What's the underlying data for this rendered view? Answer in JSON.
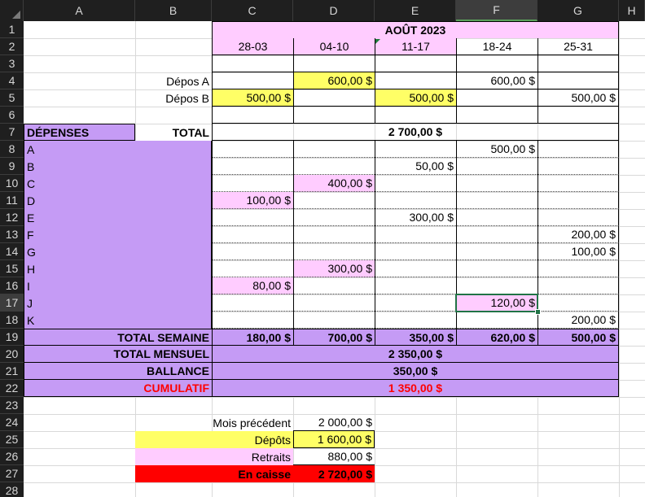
{
  "columns": [
    "A",
    "B",
    "C",
    "D",
    "E",
    "F",
    "G",
    "H"
  ],
  "rows": [
    "1",
    "2",
    "3",
    "4",
    "5",
    "6",
    "7",
    "8",
    "9",
    "10",
    "11",
    "12",
    "13",
    "14",
    "15",
    "16",
    "17",
    "18",
    "19",
    "20",
    "21",
    "22",
    "23",
    "24",
    "25",
    "26",
    "27",
    "28"
  ],
  "selected_column": "F",
  "selected_row": "17",
  "header": {
    "month": "AOÛT 2023",
    "weeks": [
      "28-03",
      "04-10",
      "11-17",
      "18-24",
      "25-31"
    ]
  },
  "deposits": {
    "label_a": "Dépos A",
    "label_b": "Dépos B",
    "a_values": [
      "",
      "600,00 $",
      "",
      "600,00 $",
      ""
    ],
    "b_values": [
      "500,00 $",
      "",
      "500,00 $",
      "",
      "500,00 $"
    ]
  },
  "expenses": {
    "title": "DÉPENSES",
    "total_label": "TOTAL",
    "total_value": "2 700,00 $",
    "items": [
      {
        "name": "A",
        "values": [
          "",
          "",
          "",
          "500,00 $",
          ""
        ]
      },
      {
        "name": "B",
        "values": [
          "",
          "",
          "50,00 $",
          "",
          ""
        ]
      },
      {
        "name": "C",
        "values": [
          "",
          "400,00 $",
          "",
          "",
          ""
        ]
      },
      {
        "name": "D",
        "values": [
          "100,00 $",
          "",
          "",
          "",
          ""
        ]
      },
      {
        "name": "E",
        "values": [
          "",
          "",
          "300,00 $",
          "",
          ""
        ]
      },
      {
        "name": "F",
        "values": [
          "",
          "",
          "",
          "",
          "200,00 $"
        ]
      },
      {
        "name": "G",
        "values": [
          "",
          "",
          "",
          "",
          "100,00 $"
        ]
      },
      {
        "name": "H",
        "values": [
          "",
          "300,00 $",
          "",
          "",
          ""
        ]
      },
      {
        "name": "I",
        "values": [
          "80,00 $",
          "",
          "",
          "",
          ""
        ]
      },
      {
        "name": "J",
        "values": [
          "",
          "",
          "",
          "120,00 $",
          ""
        ]
      },
      {
        "name": "K",
        "values": [
          "",
          "",
          "",
          "",
          "200,00 $"
        ]
      }
    ]
  },
  "totals": {
    "week_label": "TOTAL SEMAINE",
    "week_values": [
      "180,00 $",
      "700,00 $",
      "350,00 $",
      "620,00 $",
      "500,00 $"
    ],
    "monthly_label": "TOTAL MENSUEL",
    "monthly_value": "2 350,00 $",
    "balance_label": "BALLANCE",
    "balance_value": "350,00 $",
    "cumulative_label": "CUMULATIF",
    "cumulative_value": "1 350,00 $"
  },
  "summary": {
    "prev_label": "Mois précédent",
    "prev_value": "2 000,00 $",
    "deposits_label": "Dépôts",
    "deposits_value": "1 600,00 $",
    "withdrawals_label": "Retraits",
    "withdrawals_value": "880,00 $",
    "cash_label": "En caisse",
    "cash_value": "2 720,00 $"
  },
  "colors": {
    "pink": "#ffccff",
    "yellow": "#ffff66",
    "purple": "#c59bf5",
    "red": "#ff0000",
    "selection": "#217346"
  }
}
